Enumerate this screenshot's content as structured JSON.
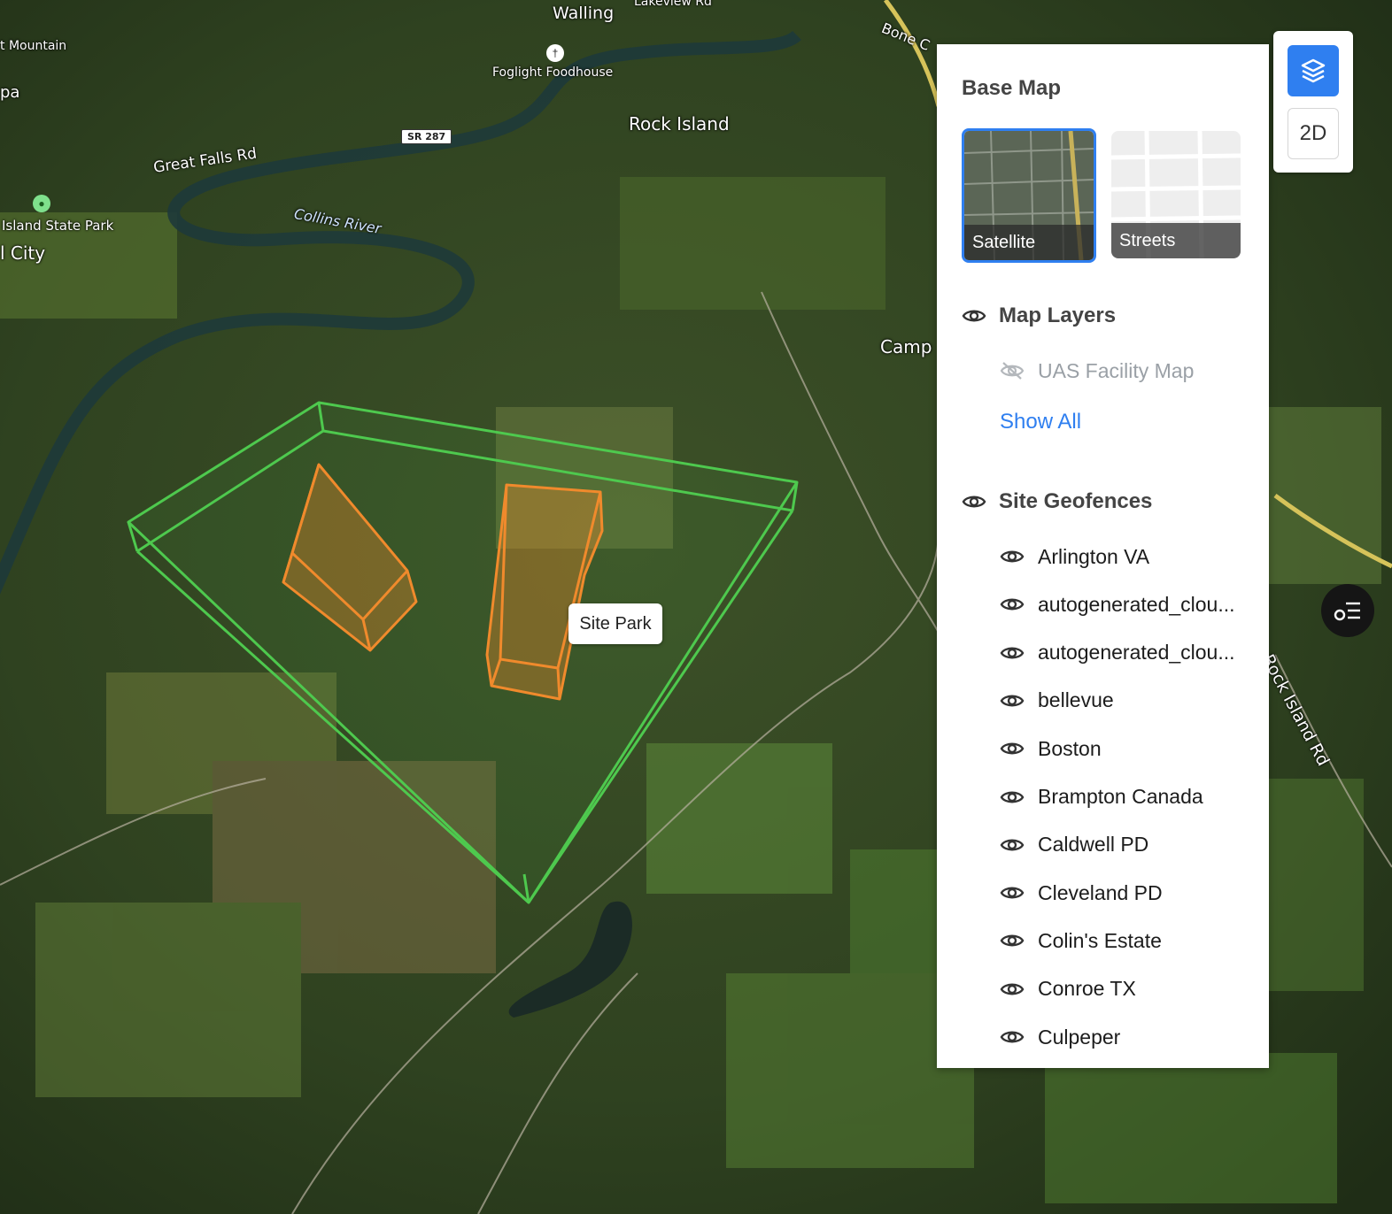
{
  "map": {
    "labels": {
      "walling": "Walling",
      "lakeview": "Lakeview Rd",
      "bone": "Bone C",
      "mountain": "t Mountain",
      "pa": "pa",
      "foodhouse": "Foglight Foodhouse",
      "rock_island": "Rock Island",
      "sr": "SR 287",
      "great_falls": "Great Falls Rd",
      "collins": "Collins River",
      "state_park": "Island State Park",
      "city": "l City",
      "camp": "Camp",
      "rock_island_rd": "Rock Island Rd"
    },
    "tooltip": "Site Park",
    "colors": {
      "outer_geofence": "#4ec94e",
      "inner_geofence": "#f08a2c"
    }
  },
  "panel": {
    "base_map_title": "Base Map",
    "base_maps": [
      {
        "label": "Satellite",
        "selected": true
      },
      {
        "label": "Streets",
        "selected": false
      }
    ],
    "map_layers_title": "Map Layers",
    "map_layers": [
      {
        "label": "UAS Facility Map",
        "visible": false
      }
    ],
    "show_all": "Show All",
    "site_geofences_title": "Site Geofences",
    "site_geofences": [
      "Arlington VA",
      "autogenerated_clou...",
      "autogenerated_clou...",
      "bellevue",
      "Boston",
      "Brampton Canada",
      "Caldwell PD",
      "Cleveland PD",
      "Colin's Estate",
      "Conroe TX",
      "Culpeper"
    ]
  },
  "controls": {
    "layers_icon": "layers-icon",
    "mode": "2D",
    "legend_icon": "legend-filter-icon",
    "accent": "#2f7ff0"
  }
}
